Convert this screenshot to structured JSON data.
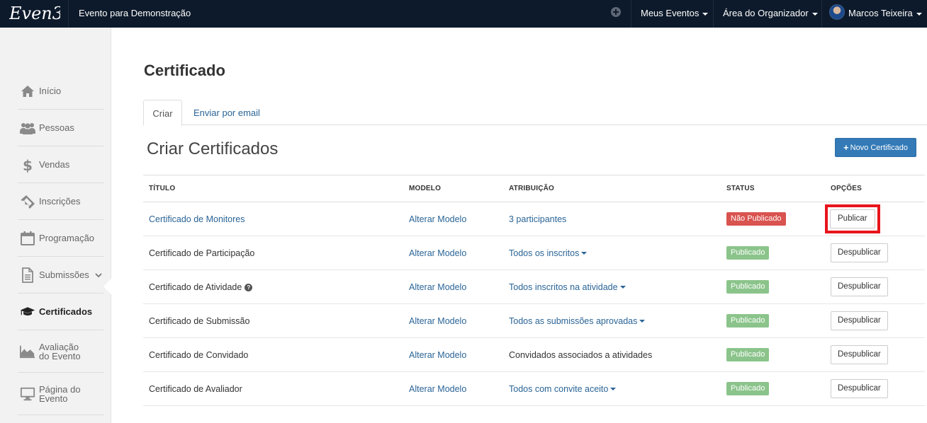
{
  "topbar": {
    "logo": "Even3",
    "event_name": "Evento para Demonstração",
    "menu_meus_eventos": "Meus Eventos",
    "menu_area_organizador": "Área do Organizador",
    "user_name": "Marcos Teixeira"
  },
  "sidebar": {
    "items": [
      {
        "label": "Início",
        "icon": "home-icon"
      },
      {
        "label": "Pessoas",
        "icon": "users-icon"
      },
      {
        "label": "Vendas",
        "icon": "dollar-icon"
      },
      {
        "label": "Inscrições",
        "icon": "ticket-icon"
      },
      {
        "label": "Programação",
        "icon": "calendar-icon"
      },
      {
        "label": "Submissões",
        "icon": "document-icon"
      },
      {
        "label": "Certificados",
        "icon": "graduation-cap-icon"
      },
      {
        "label_line1": "Avaliação",
        "label_line2": "do Evento",
        "icon": "area-chart-icon"
      },
      {
        "label_line1": "Página do",
        "label_line2": "Evento",
        "icon": "monitor-icon"
      }
    ],
    "active": "Certificados"
  },
  "main": {
    "page_title": "Certificado",
    "tabs": [
      {
        "label": "Criar",
        "active": true
      },
      {
        "label": "Enviar por email",
        "active": false
      }
    ],
    "section_title": "Criar Certificados",
    "new_button": "Novo Certificado",
    "table": {
      "headers": [
        "TÍTULO",
        "MODELO",
        "ATRIBUIÇÃO",
        "STATUS",
        "OPÇÕES"
      ],
      "rows": [
        {
          "title": "Certificado de Monitores",
          "title_link": true,
          "model": "Alterar Modelo",
          "assignment": "3 participantes",
          "assignment_dropdown": false,
          "assignment_link": true,
          "status": "Não Publicado",
          "option": "Publicar"
        },
        {
          "title": "Certificado de Participação",
          "title_link": false,
          "model": "Alterar Modelo",
          "assignment": "Todos os inscritos",
          "assignment_dropdown": true,
          "assignment_link": true,
          "status": "Publicado",
          "option": "Despublicar"
        },
        {
          "title": "Certificado de Atividade",
          "title_link": false,
          "help": "?",
          "model": "Alterar Modelo",
          "assignment": "Todos inscritos na atividade",
          "assignment_dropdown": true,
          "assignment_link": true,
          "status": "Publicado",
          "option": "Despublicar"
        },
        {
          "title": "Certificado de Submissão",
          "title_link": false,
          "model": "Alterar Modelo",
          "assignment": "Todos as submissões aprovadas",
          "assignment_dropdown": true,
          "assignment_link": true,
          "status": "Publicado",
          "option": "Despublicar"
        },
        {
          "title": "Certificado de Convidado",
          "title_link": false,
          "model": "Alterar Modelo",
          "assignment": "Convidados associados a atividades",
          "assignment_dropdown": false,
          "assignment_link": false,
          "status": "Publicado",
          "option": "Despublicar"
        },
        {
          "title": "Certificado de Avaliador",
          "title_link": false,
          "model": "Alterar Modelo",
          "assignment": "Todos com convite aceito",
          "assignment_dropdown": true,
          "assignment_link": true,
          "status": "Publicado",
          "option": "Despublicar"
        }
      ]
    }
  },
  "colors": {
    "topbar": "#0d1a2b",
    "link": "#2a6496",
    "primary": "#337ab7",
    "danger": "#d9534f",
    "success": "#8bc48b",
    "highlight": "#e8141b"
  }
}
